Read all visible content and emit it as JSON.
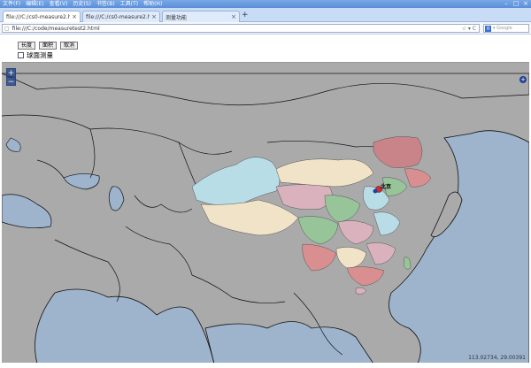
{
  "window": {
    "menu": [
      "文件(F)",
      "编辑(E)",
      "查看(V)",
      "历史(S)",
      "书签(B)",
      "工具(T)",
      "帮助(H)"
    ],
    "controls": [
      "–",
      "□",
      "×"
    ]
  },
  "tabs": [
    {
      "label": "file:///C:/cs0-measure2.html"
    },
    {
      "label": "file:///C:/cs0-measure2.html"
    },
    {
      "label": "测量功能"
    }
  ],
  "tab_add": "+",
  "address": {
    "url": "file:///C:/code/measuretest2.html",
    "tail": "☆ ▾ C"
  },
  "search": {
    "engine": "g",
    "placeholder": "▾ Google"
  },
  "page": {
    "buttons": {
      "length": "长度",
      "area": "面积",
      "cancel": "取消"
    },
    "geodesic_label": "球面测量"
  },
  "map": {
    "zoom_in": "+",
    "zoom_out": "−",
    "layer_switcher": "+",
    "city": "北京",
    "cursor_coords": "113.02734, 29.00391",
    "colors": {
      "sea": "#9eb4cc",
      "land": "#aaaaaa",
      "border": "#111111"
    }
  }
}
